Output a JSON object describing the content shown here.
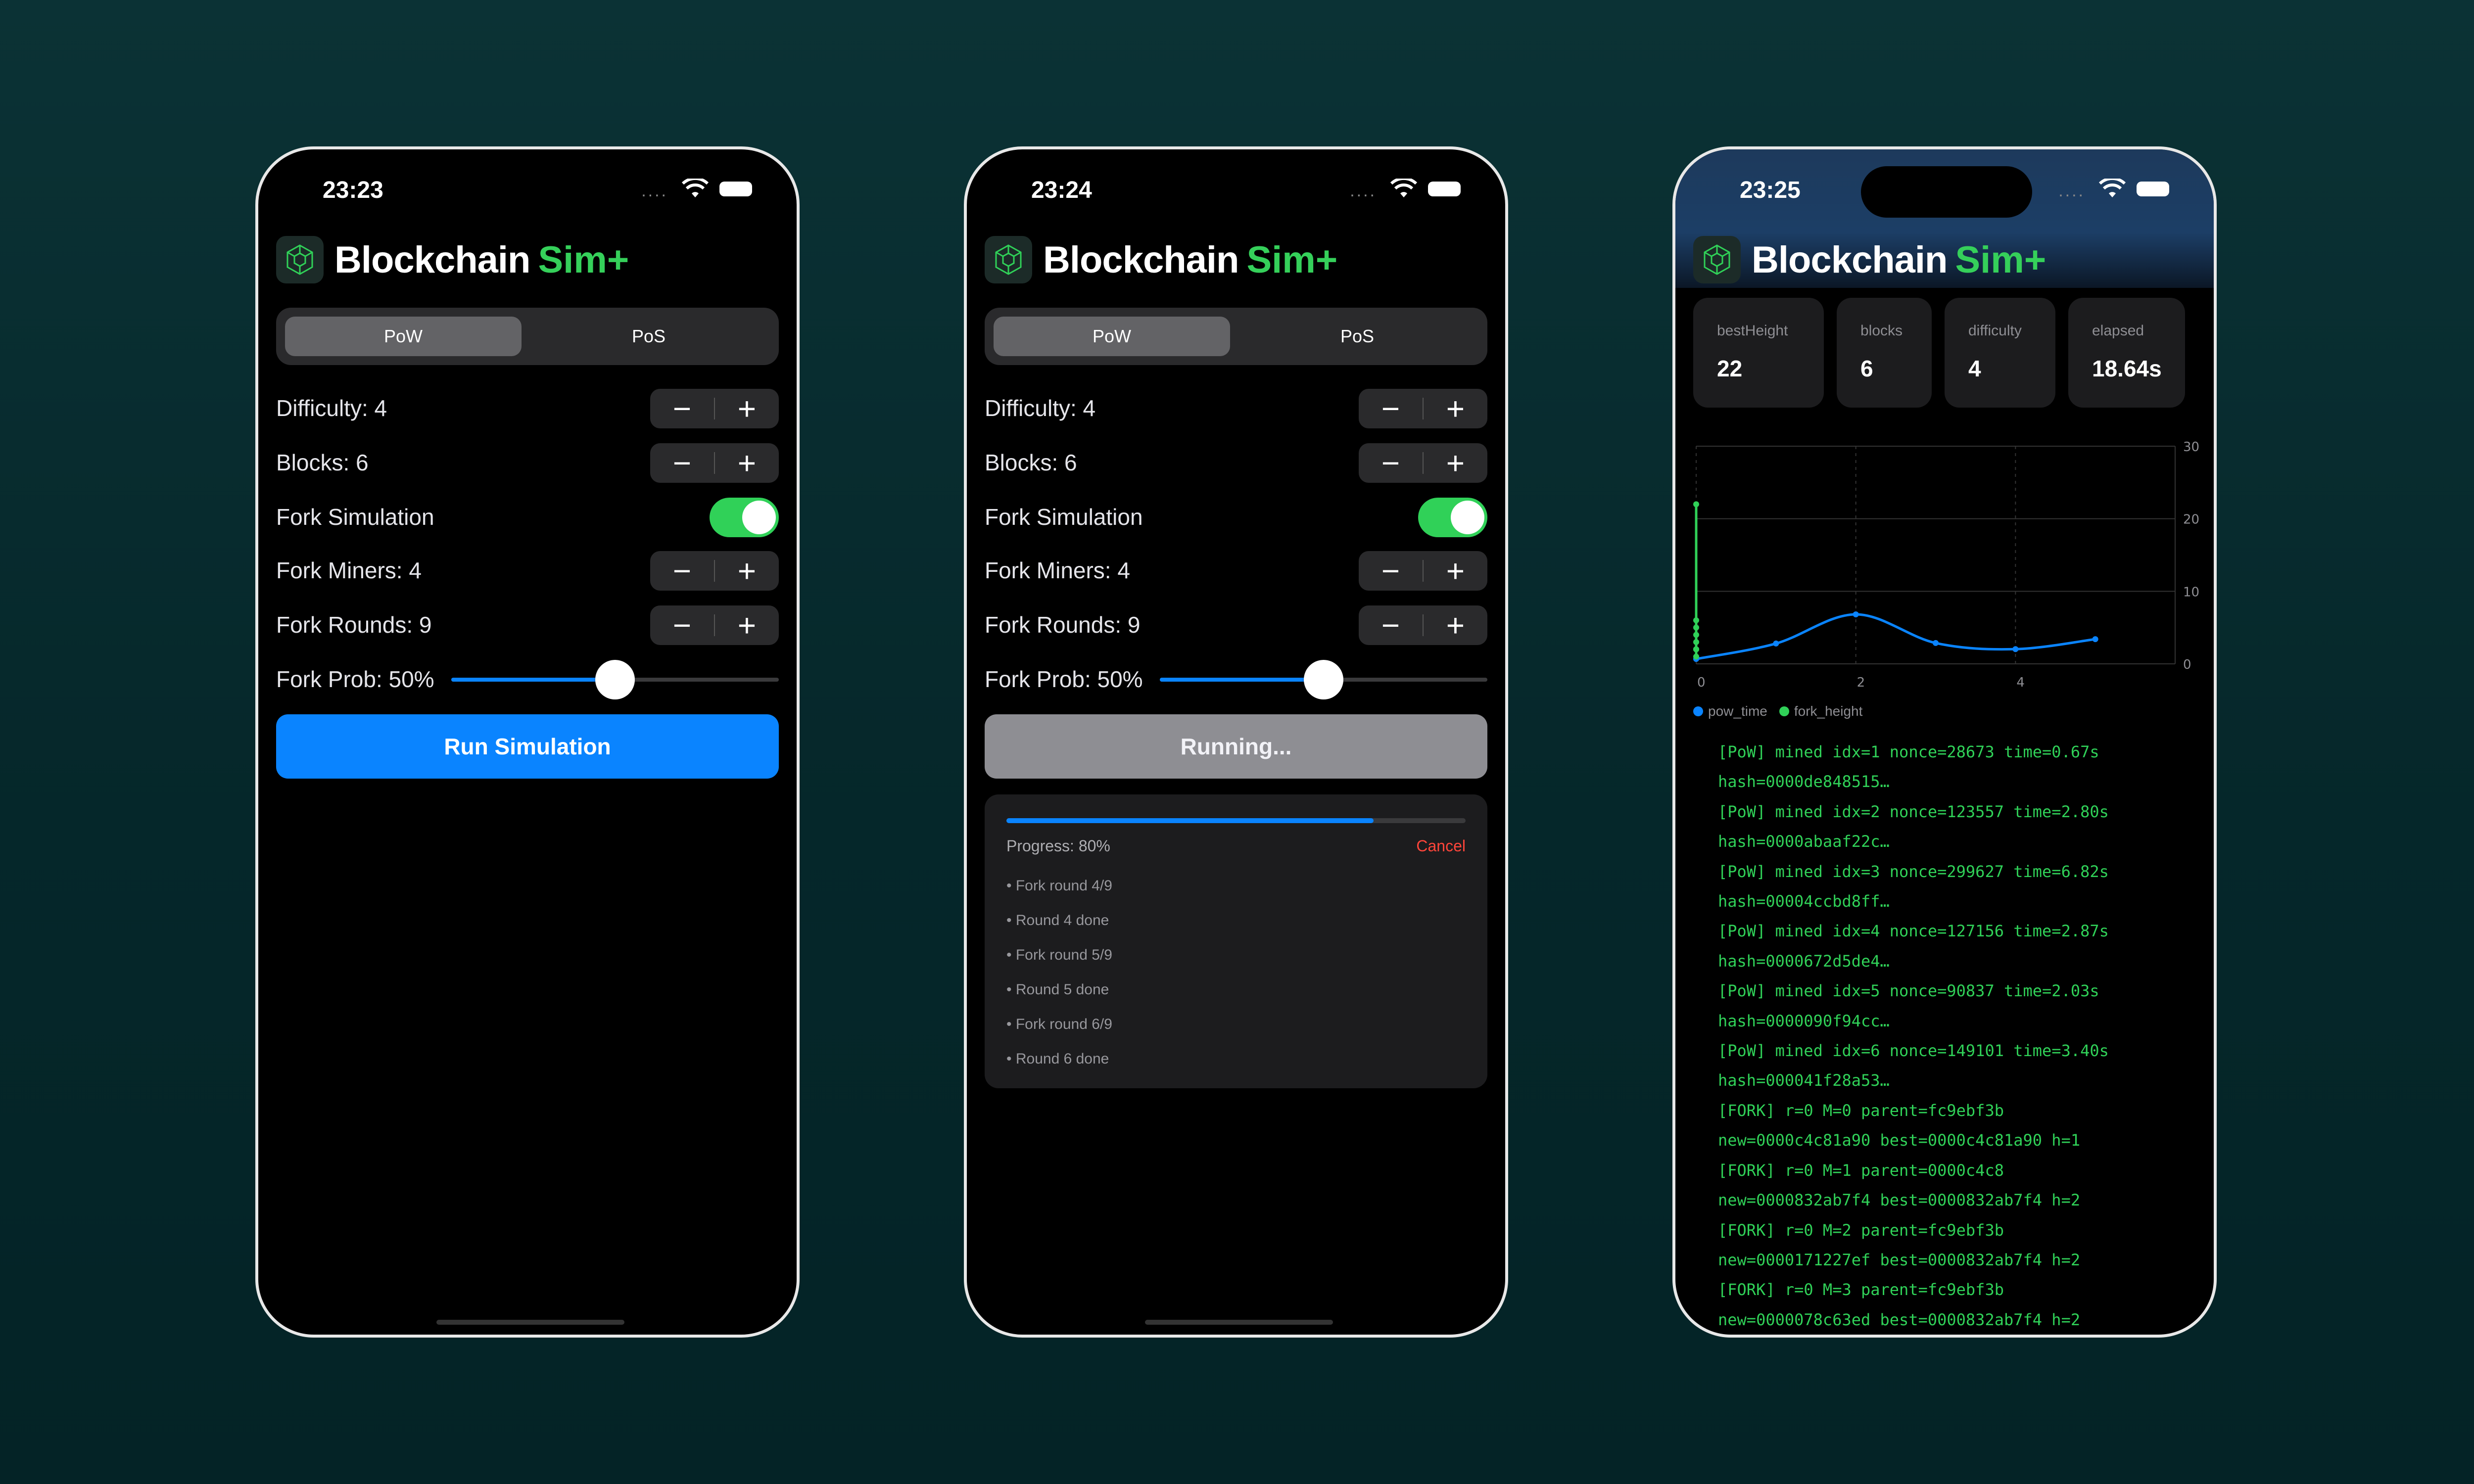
{
  "app": {
    "title": "Blockchain",
    "title_accent": "Sim+"
  },
  "phones": [
    {
      "time": "23:23",
      "tabs": [
        "PoW",
        "PoS"
      ],
      "difficulty_label": "Difficulty: 4",
      "blocks_label": "Blocks: 6",
      "fork_sim_label": "Fork Simulation",
      "fork_miners_label": "Fork Miners: 4",
      "fork_rounds_label": "Fork Rounds: 9",
      "fork_prob_label": "Fork Prob: 50%",
      "fork_prob_value": 0.5,
      "run_button": "Run Simulation"
    },
    {
      "time": "23:24",
      "tabs": [
        "PoW",
        "PoS"
      ],
      "difficulty_label": "Difficulty: 4",
      "blocks_label": "Blocks: 6",
      "fork_sim_label": "Fork Simulation",
      "fork_miners_label": "Fork Miners: 4",
      "fork_rounds_label": "Fork Rounds: 9",
      "fork_prob_label": "Fork Prob: 50%",
      "fork_prob_value": 0.5,
      "run_button": "Running...",
      "progress": {
        "value": 0.8,
        "label": "Progress: 80%",
        "cancel": "Cancel",
        "log": [
          "Fork round 4/9",
          "Round 4 done",
          "Fork round 5/9",
          "Round 5 done",
          "Fork round 6/9",
          "Round 6 done"
        ]
      }
    },
    {
      "time": "23:25",
      "stats": [
        {
          "key": "bestHeight",
          "value": "22"
        },
        {
          "key": "blocks",
          "value": "6"
        },
        {
          "key": "difficulty",
          "value": "4"
        },
        {
          "key": "elapsed",
          "value": "18.64s"
        }
      ],
      "log": [
        "[PoW] mined idx=1 nonce=28673 time=0.67s",
        "hash=0000de848515…",
        "[PoW] mined idx=2 nonce=123557 time=2.80s",
        "hash=0000abaaf22c…",
        "[PoW] mined idx=3 nonce=299627 time=6.82s",
        "hash=00004ccbd8ff…",
        "[PoW] mined idx=4 nonce=127156 time=2.87s",
        "hash=0000672d5de4…",
        "[PoW] mined idx=5 nonce=90837 time=2.03s",
        "hash=0000090f94cc…",
        "[PoW] mined idx=6 nonce=149101 time=3.40s",
        "hash=000041f28a53…",
        "[FORK] r=0 M=0 parent=fc9ebf3b",
        "new=0000c4c81a90 best=0000c4c81a90 h=1",
        "[FORK] r=0 M=1 parent=0000c4c8",
        "new=0000832ab7f4 best=0000832ab7f4 h=2",
        "[FORK] r=0 M=2 parent=fc9ebf3b",
        "new=0000171227ef best=0000832ab7f4 h=2",
        "[FORK] r=0 M=3 parent=fc9ebf3b",
        "new=0000078c63ed best=0000832ab7f4 h=2"
      ]
    }
  ],
  "chart_data": {
    "type": "line",
    "xlim": [
      0,
      6
    ],
    "ylim": [
      0,
      30
    ],
    "x_ticks": [
      "0",
      "2",
      "4"
    ],
    "y_ticks": [
      "0",
      "10",
      "20",
      "30"
    ],
    "legend_position": "bottom-left",
    "series": [
      {
        "name": "pow_time",
        "color": "#0a84ff",
        "x": [
          0,
          1,
          2,
          3,
          4,
          5
        ],
        "y": [
          0.67,
          2.8,
          6.82,
          2.87,
          2.03,
          3.4
        ]
      },
      {
        "name": "fork_height",
        "color": "#30d158",
        "x": [
          0,
          0,
          0,
          0,
          0,
          0,
          0,
          0,
          0
        ],
        "y": [
          1,
          2,
          2,
          2,
          3,
          4,
          5,
          6,
          22
        ]
      }
    ]
  }
}
